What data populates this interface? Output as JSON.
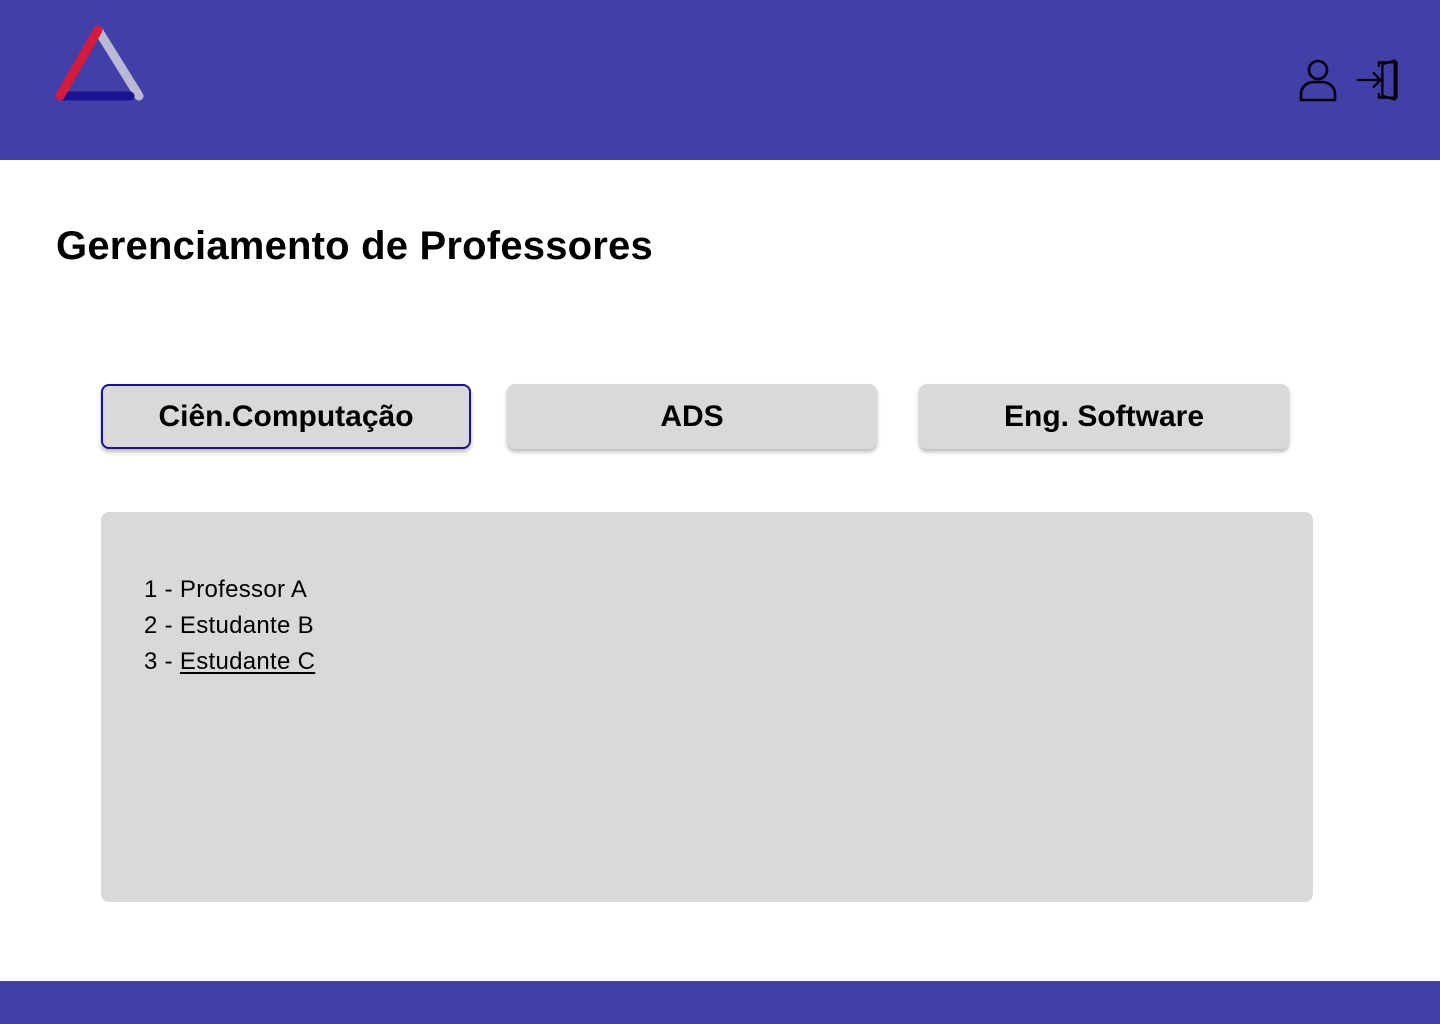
{
  "header": {
    "logo_icon": "triangle-logo-icon",
    "background_color": "#433fa8",
    "actions": [
      {
        "icon": "user-icon"
      },
      {
        "icon": "logout-door-icon"
      }
    ]
  },
  "page_title": "Gerenciamento de Professores",
  "tabs": [
    {
      "label": "Ciên.Computação",
      "active": true
    },
    {
      "label": "ADS",
      "active": false
    },
    {
      "label": "Eng. Software",
      "active": false
    }
  ],
  "list": {
    "items": [
      {
        "number": "1",
        "separator": " - ",
        "name": "Professor A"
      },
      {
        "number": "2",
        "separator": " - ",
        "name": "Estudante B"
      },
      {
        "number": "3",
        "separator": " - ",
        "name": "Estudante C"
      }
    ]
  },
  "colors": {
    "accent": "#433fa8",
    "panel": "#d9d9d9",
    "active_border": "#1a1290",
    "logo_red": "#d61a3c",
    "logo_blue": "#1a1290",
    "logo_gray": "#b9b9d6"
  }
}
